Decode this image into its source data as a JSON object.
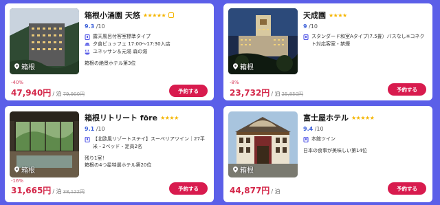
{
  "colors": {
    "background": "#5b5fe8",
    "price": "#d4284a",
    "button": "#d81b4e",
    "score": "#3b5fd9",
    "star": "#f5b500"
  },
  "hotels": [
    {
      "name": "箱根小涌園 天悠",
      "stars": "★★★★★",
      "score": "9.3",
      "score_max": "/10",
      "features": [
        "露天風呂付客室標準タイプ",
        "夕食ビュッフェ 17:00〜17:30入店",
        "ユネッサン＆元湯 森の湯"
      ],
      "feature_icons": [
        "room-icon",
        "dinner-icon",
        "bath-icon"
      ],
      "note": "箱根の絶景ホテル第3位",
      "location": "箱根",
      "discount": "-40%",
      "price": "47,940円",
      "per": "/ 泊",
      "original_price": "79,900円",
      "book_label": "予約する"
    },
    {
      "name": "天成園",
      "stars": "★★★★",
      "score": "9",
      "score_max": "/10",
      "features": [
        "スタンダード和室Aタイプ(7.5畳）バスなし※コネクト対応客室・禁煙"
      ],
      "feature_icons": [
        "room-icon"
      ],
      "location": "箱根",
      "discount": "-8%",
      "price": "23,732円",
      "per": "/ 泊",
      "original_price": "25,850円",
      "book_label": "予約する"
    },
    {
      "name": "箱根リトリート före",
      "stars": "★★★★",
      "score": "9.1",
      "score_max": "/10",
      "features": [
        "【北欧風リゾートステイ】スーペリアツイン｜27平米・2ベッド・定員2名"
      ],
      "feature_icons": [
        "room-icon"
      ],
      "note1": "残り1室！",
      "note2": "箱根の4つ星特選ホテル第20位",
      "location": "箱根",
      "discount": "-16%",
      "price": "31,665円",
      "per": "/ 泊",
      "original_price": "38,122円",
      "book_label": "予約する"
    },
    {
      "name": "富士屋ホテル",
      "stars": "★★★★★",
      "score": "9.4",
      "score_max": "/10",
      "features": [
        "本館ツイン"
      ],
      "feature_icons": [
        "room-icon"
      ],
      "note": "日本の食事が美味しい第14位",
      "location": "箱根",
      "price": "44,877円",
      "per": "/ 泊",
      "book_label": "予約する"
    }
  ]
}
